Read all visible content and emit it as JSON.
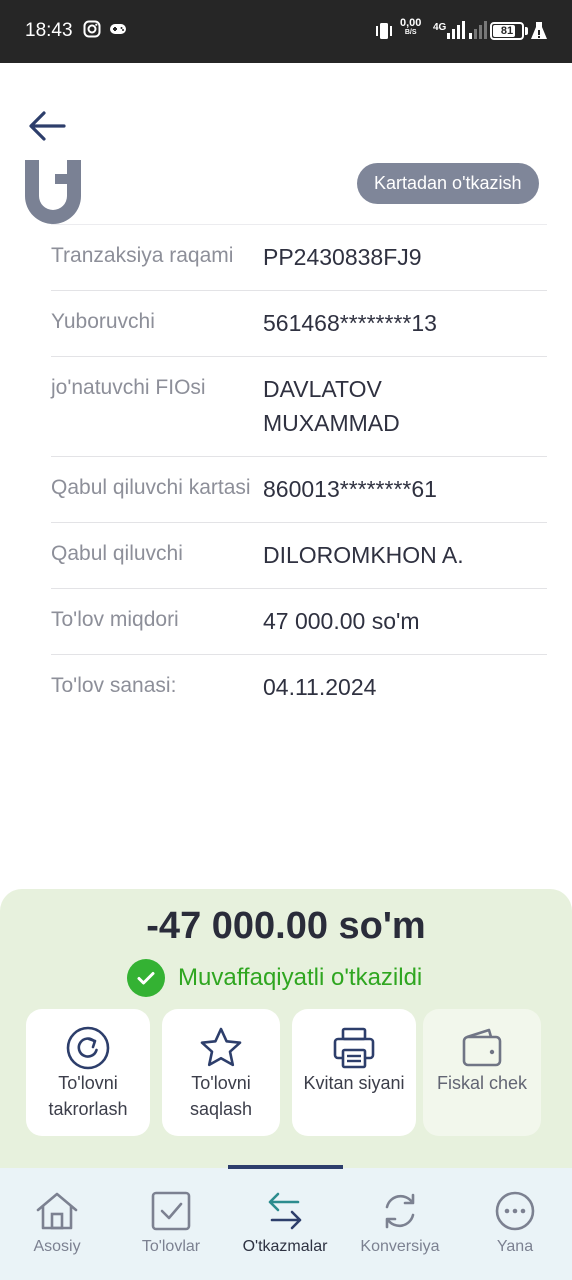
{
  "status_bar": {
    "time": "18:43",
    "speed_value": "0,00",
    "speed_unit": "B/S",
    "network": "4G",
    "battery": "81",
    "battery_level": 0.81
  },
  "header": {
    "back_icon": "arrow-left-icon",
    "transfer_type": "Kartadan o'tkazish"
  },
  "details": [
    {
      "label": "Tranzaksiya raqami",
      "value": "PP2430838FJ9"
    },
    {
      "label": "Yuboruvchi",
      "value": "561468********13"
    },
    {
      "label": "jo'natuvchi FIOsi",
      "value": "DAVLATOV MUXAMMAD"
    },
    {
      "label": "Qabul qiluvchi kartasi",
      "value": "860013********61"
    },
    {
      "label": "Qabul qiluvchi",
      "value": "DILOROMKHON A."
    },
    {
      "label": "To'lov miqdori",
      "value": "47 000.00 so'm"
    },
    {
      "label": "To'lov sanasi:",
      "value": "04.11.2024"
    }
  ],
  "result": {
    "amount": "-47 000.00 so'm",
    "status": "Muvaffaqiyatli o'tkazildi",
    "status_color": "#2fa620"
  },
  "actions": [
    {
      "label": "To'lovni takrorlash",
      "icon": "repeat-icon"
    },
    {
      "label": "To'lovni saqlash",
      "icon": "star-icon"
    },
    {
      "label": "Kvitan siyani",
      "icon": "printer-icon"
    },
    {
      "label": "Fiskal chek",
      "icon": "wallet-icon"
    }
  ],
  "nav": {
    "active": "O'tkazmalar",
    "items": [
      {
        "label": "Asosiy",
        "icon": "home-icon"
      },
      {
        "label": "To'lovlar",
        "icon": "checkbox-icon"
      },
      {
        "label": "O'tkazmalar",
        "icon": "transfer-arrows-icon"
      },
      {
        "label": "Konversiya",
        "icon": "refresh-icon"
      },
      {
        "label": "Yana",
        "icon": "more-icon"
      }
    ]
  },
  "colors": {
    "accent": "#2d3e6b",
    "success": "#34b233",
    "panel_bg": "#e7f1dd",
    "pill_bg": "#7f8699"
  }
}
